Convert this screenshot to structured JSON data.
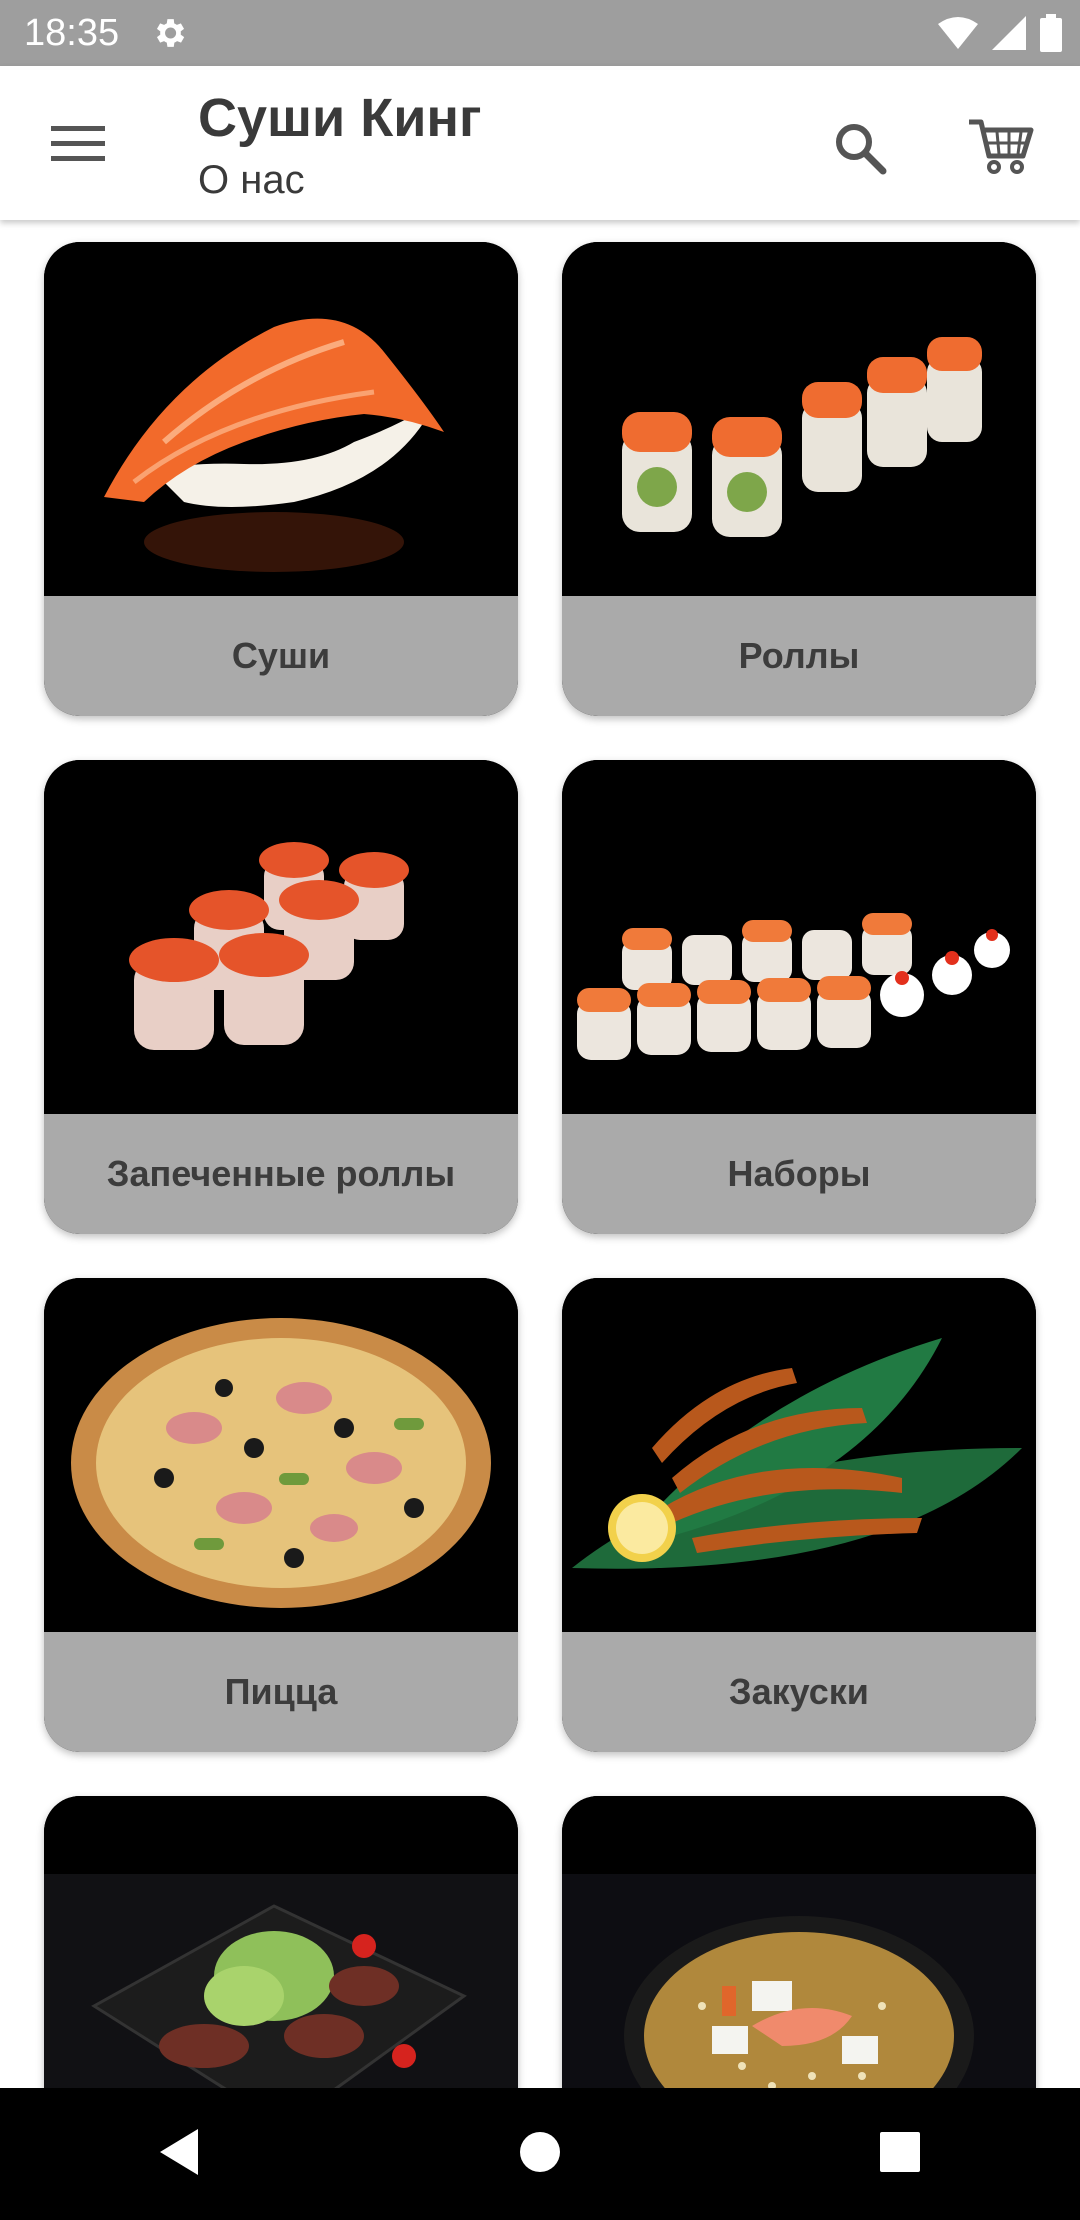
{
  "status_bar": {
    "time": "18:35",
    "icons": [
      "settings-gear-icon",
      "wifi-icon",
      "signal-icon",
      "battery-icon"
    ]
  },
  "app_bar": {
    "title": "Суши Кинг",
    "subtitle": "О нас",
    "icons": [
      "menu-icon",
      "search-icon",
      "cart-icon"
    ]
  },
  "categories": [
    {
      "label": "Суши"
    },
    {
      "label": "Роллы"
    },
    {
      "label": "Запеченные роллы"
    },
    {
      "label": "Наборы"
    },
    {
      "label": "Пицца"
    },
    {
      "label": "Закуски"
    },
    {
      "label": ""
    },
    {
      "label": ""
    }
  ],
  "nav_bar": {
    "icons": [
      "back-icon",
      "home-icon",
      "recents-icon"
    ]
  },
  "colors": {
    "status_bar": "#9e9e9e",
    "card_label_bg": "#aaaaaa",
    "card_bg": "#000000",
    "text": "#3a3a3a"
  }
}
